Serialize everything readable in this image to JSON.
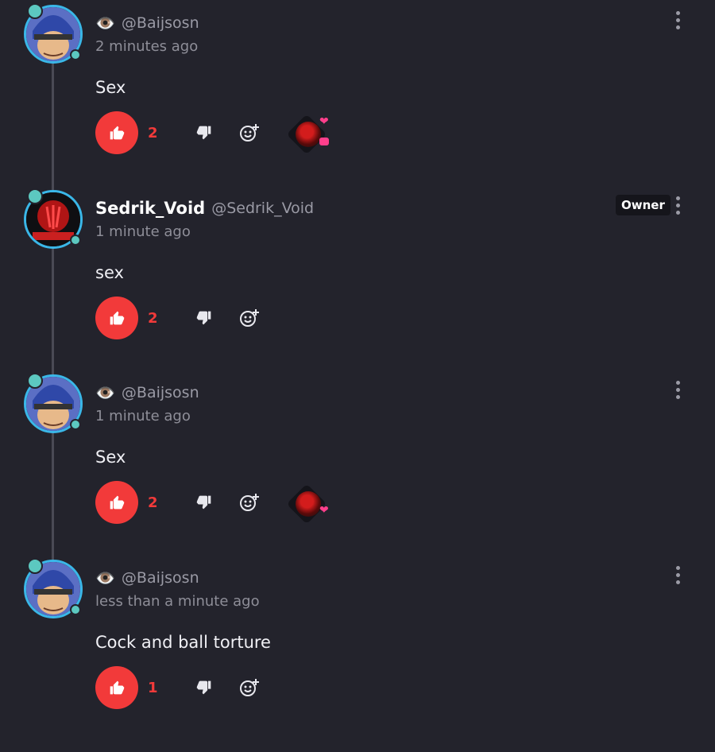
{
  "comments": [
    {
      "show_eye": true,
      "name": "",
      "handle": "@Baijsosn",
      "time": "2 minutes ago",
      "text": "Sex",
      "likes": "2",
      "owner_badge": "",
      "owner_reaction": true,
      "reaction_hearts": [
        "heart",
        "chat"
      ],
      "avatar": "blue-character"
    },
    {
      "show_eye": false,
      "name": "Sedrik_Void",
      "handle": "@Sedrik_Void",
      "time": "1 minute ago",
      "text": "sex",
      "likes": "2",
      "owner_badge": "Owner",
      "owner_reaction": false,
      "avatar": "red-logo"
    },
    {
      "show_eye": true,
      "name": "",
      "handle": "@Baijsosn",
      "time": "1 minute ago",
      "text": "Sex",
      "likes": "2",
      "owner_badge": "",
      "owner_reaction": true,
      "reaction_hearts": [
        "heart"
      ],
      "avatar": "blue-character"
    },
    {
      "show_eye": true,
      "name": "",
      "handle": "@Baijsosn",
      "time": "less than a minute ago",
      "text": "Cock and ball torture",
      "likes": "1",
      "owner_badge": "",
      "owner_reaction": false,
      "avatar": "blue-character"
    }
  ],
  "icons": {
    "eye": "👁️",
    "like": "thumbs-up-icon",
    "dislike": "thumbs-down-icon",
    "react": "add-reaction-icon",
    "menu": "kebab-menu-icon"
  },
  "colors": {
    "background": "#23232c",
    "like": "#f23a3a",
    "avatar_ring": "#3ab7e8",
    "heart": "#ff3f8c"
  }
}
